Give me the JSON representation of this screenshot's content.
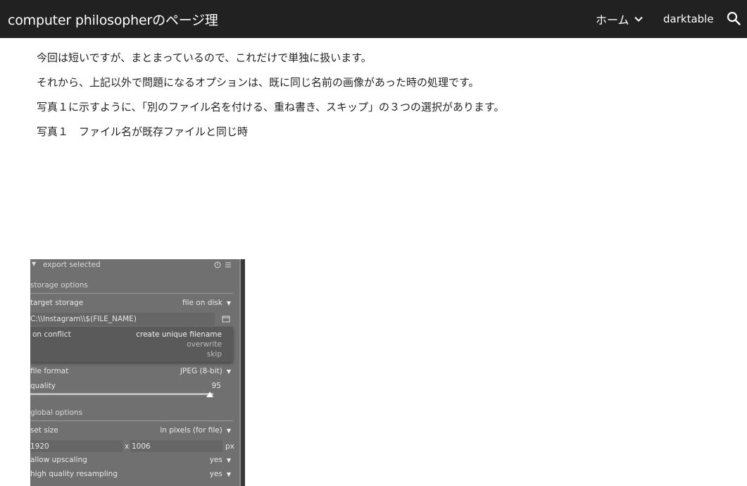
{
  "header": {
    "site_title": "computer philosopherのページ理",
    "nav": {
      "home_label": "ホーム",
      "darktable_label": "darktable"
    },
    "icons": {
      "chevron": "chevron-down-icon",
      "search": "search-icon"
    },
    "background": "#212121"
  },
  "article": {
    "paragraphs": [
      "今回は短いですが、まとまっているので、これだけで単独に扱います。",
      "それから、上記以外で問題になるオプションは、既に同じ名前の画像があった時の処理です。",
      "写真１に示すように、「別のファイル名を付ける、重ね書き、スキップ」の３つの選択があります。",
      "写真１　ファイル名が既存ファイルと同じ時"
    ]
  },
  "screenshot": {
    "panel_title": "export selected",
    "storage_section": "storage options",
    "target_storage_label": "target storage",
    "target_storage_value": "file on disk",
    "path_value": "C:\\\\Instagram\\\\$(FILE_NAME)",
    "on_conflict_label": "on conflict",
    "conflict_options": [
      "create unique filename",
      "overwrite",
      "skip"
    ],
    "file_format_label": "file format",
    "file_format_value": "JPEG (8-bit)",
    "quality_label": "quality",
    "quality_value": "95",
    "global_section": "global options",
    "set_size_label": "set size",
    "set_size_value": "in pixels (for file)",
    "width_value": "1920",
    "times_sign": "x",
    "height_value": "1006",
    "px_unit": "px",
    "allow_upscaling_label": "allow upscaling",
    "allow_upscaling_value": "yes",
    "hq_resampling_label": "high quality resampling",
    "hq_resampling_value": "yes",
    "dropdown_glyph": "▼",
    "collapse_glyph": "▼"
  }
}
